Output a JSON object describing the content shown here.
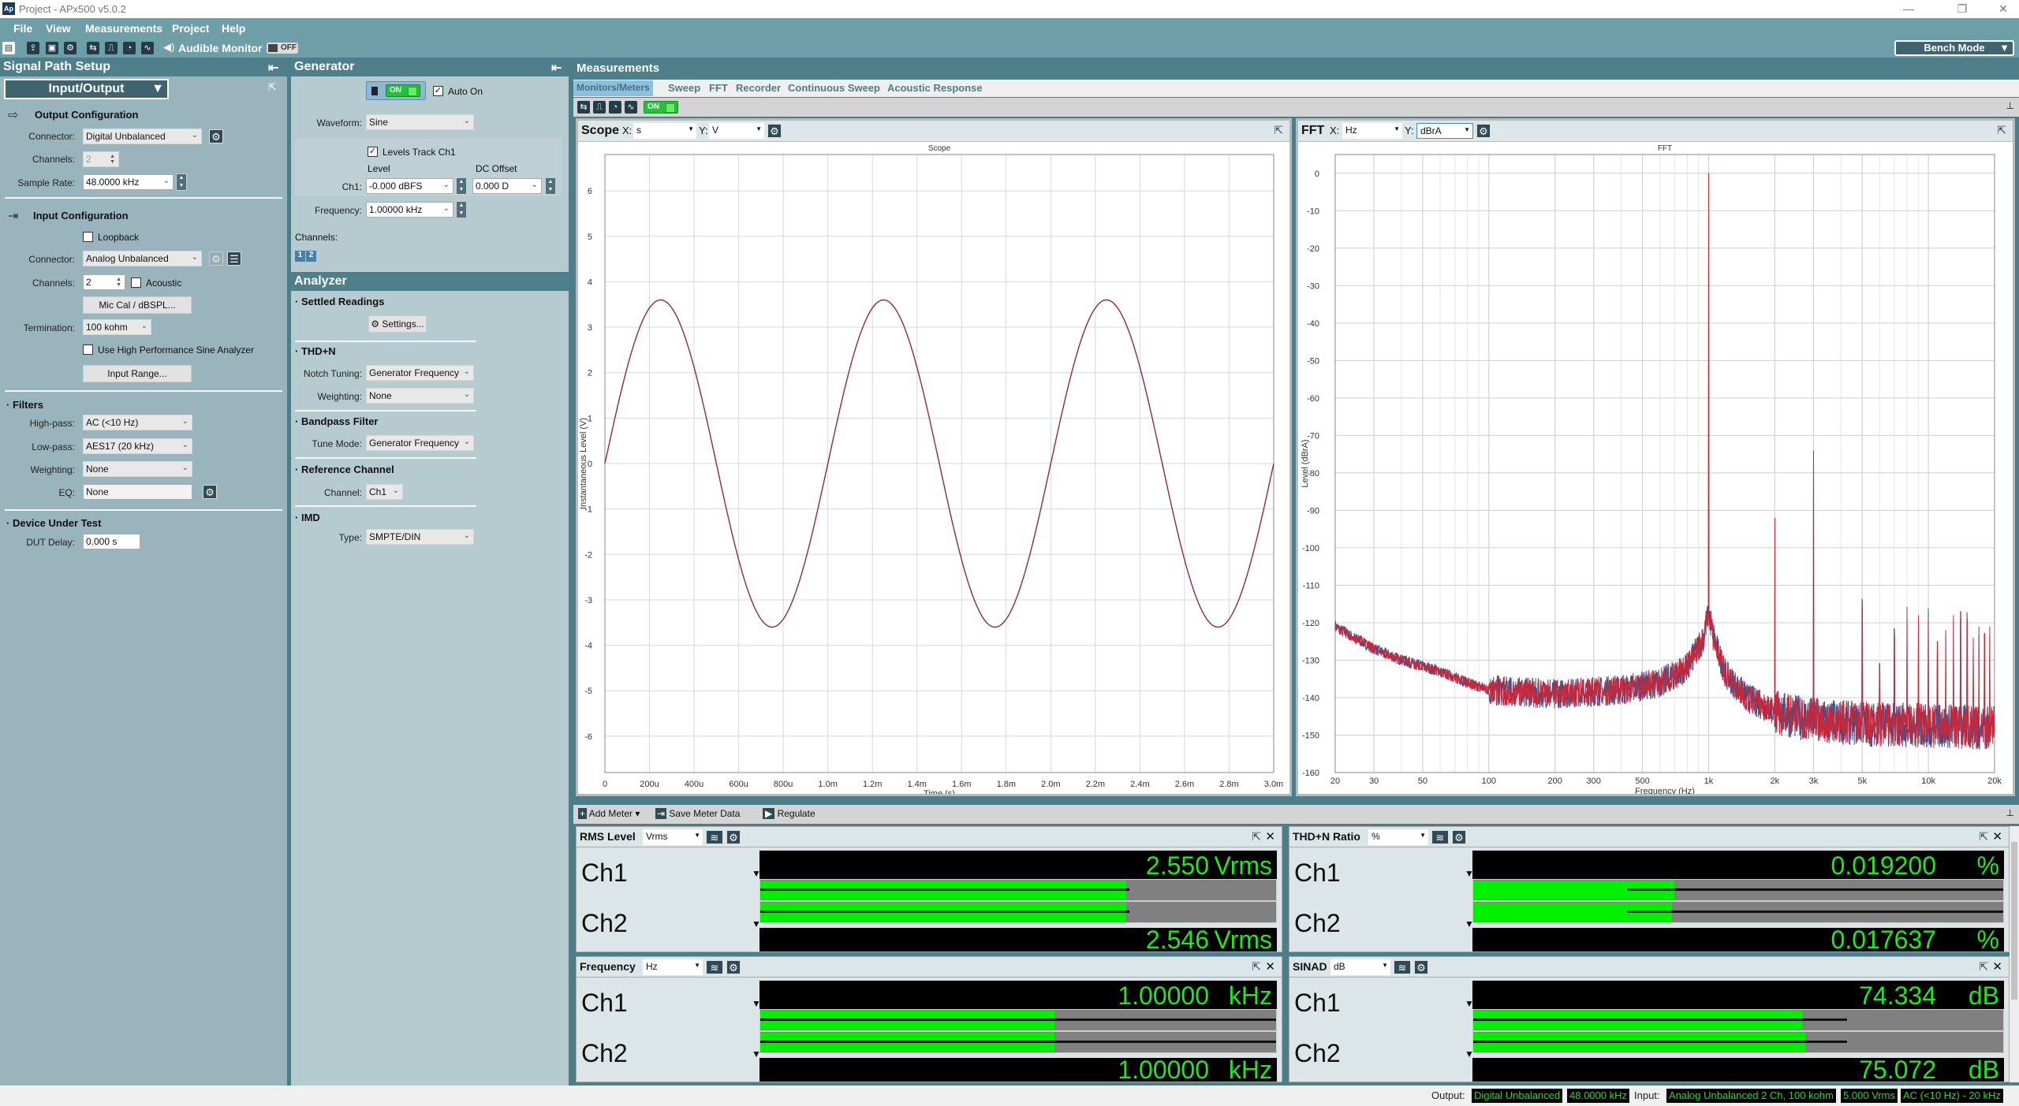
{
  "window": {
    "title": "Project - APx500 v5.0.2",
    "logo": "Ap",
    "minimize": "—",
    "restore": "❐",
    "close": "✕"
  },
  "menu": [
    "File",
    "View",
    "Measurements",
    "Project",
    "Help"
  ],
  "toolbar": {
    "audible_monitor_label": "Audible Monitor",
    "audible_monitor_state": "OFF",
    "icons": [
      "new-file-icon",
      "open-icon",
      "save-icon",
      "settings-icon",
      "routing-icon",
      "signal-icon",
      "clock-icon",
      "wave-add-icon",
      "speaker-icon"
    ],
    "mode": "Bench Mode"
  },
  "signal_path": {
    "title": "Signal Path Setup",
    "view": "Input/Output",
    "output": {
      "title": "Output Configuration",
      "connector_label": "Connector:",
      "connector": "Digital Unbalanced",
      "channels_label": "Channels:",
      "channels": "2",
      "sample_rate_label": "Sample Rate:",
      "sample_rate": "48.0000 kHz"
    },
    "input": {
      "title": "Input Configuration",
      "loopback": "Loopback",
      "loopback_checked": false,
      "connector_label": "Connector:",
      "connector": "Analog Unbalanced",
      "channels_label": "Channels:",
      "channels": "2",
      "acoustic": "Acoustic",
      "acoustic_checked": false,
      "mic_cal": "Mic Cal / dBSPL...",
      "termination_label": "Termination:",
      "termination": "100 kohm",
      "hp_sine": "Use High Performance Sine Analyzer",
      "hp_sine_checked": false,
      "input_range": "Input Range..."
    },
    "filters": {
      "title": "Filters",
      "highpass_label": "High-pass:",
      "highpass": "AC (<10 Hz)",
      "lowpass_label": "Low-pass:",
      "lowpass": "AES17 (20 kHz)",
      "weighting_label": "Weighting:",
      "weighting": "None",
      "eq_label": "EQ:",
      "eq": "None"
    },
    "dut": {
      "title": "Device Under Test",
      "delay_label": "DUT Delay:",
      "delay": "0.000 s"
    }
  },
  "generator": {
    "title": "Generator",
    "on_label": "ON",
    "auto_on": "Auto On",
    "auto_on_checked": true,
    "waveform_label": "Waveform:",
    "waveform": "Sine",
    "levels_track": "Levels Track Ch1",
    "levels_track_checked": true,
    "level_header": "Level",
    "dc_header": "DC Offset",
    "ch1_label": "Ch1:",
    "level": "-0.000 dBFS",
    "dc_offset": "0.000 D",
    "frequency_label": "Frequency:",
    "frequency": "1.00000 kHz",
    "channels_label": "Channels:",
    "channel_buttons": [
      "1",
      "2"
    ]
  },
  "analyzer": {
    "title": "Analyzer",
    "settled": "Settled Readings",
    "settings": "Settings...",
    "thdn": "THD+N",
    "notch_label": "Notch Tuning:",
    "notch": "Generator Frequency",
    "weighting_label": "Weighting:",
    "weighting": "None",
    "bandpass": "Bandpass Filter",
    "tune_label": "Tune Mode:",
    "tune": "Generator Frequency",
    "ref": "Reference Channel",
    "channel_label": "Channel:",
    "channel": "Ch1",
    "imd": "IMD",
    "type_label": "Type:",
    "type": "SMPTE/DIN"
  },
  "measurements": {
    "title": "Measurements",
    "tabs": [
      "Monitors/Meters",
      "Sweep",
      "FFT",
      "Recorder",
      "Continuous Sweep",
      "Acoustic Response"
    ],
    "active_tab": "Monitors/Meters",
    "on_label": "ON",
    "scope": {
      "name": "Scope",
      "x_label": "X:",
      "x_unit": "s",
      "y_label": "Y:",
      "y_unit": "V"
    },
    "fft": {
      "name": "FFT",
      "x_label": "X:",
      "x_unit": "Hz",
      "y_label": "Y:",
      "y_unit": "dBrA"
    },
    "meter_toolbar": {
      "add": "Add Meter",
      "save": "Save Meter Data",
      "regulate": "Regulate"
    },
    "meters": [
      {
        "name": "RMS Level",
        "unit_select": "Vrms",
        "channels": [
          {
            "ch": "Ch1",
            "value": "2.550",
            "unit": "Vrms",
            "fill": 0.71,
            "line": 0.715
          },
          {
            "ch": "Ch2",
            "value": "2.546",
            "unit": "Vrms",
            "fill": 0.71,
            "line": 0.715
          }
        ]
      },
      {
        "name": "THD+N Ratio",
        "unit_select": "%",
        "channels": [
          {
            "ch": "Ch1",
            "value": "0.019200",
            "unit": "%",
            "fill": 0.38,
            "line_from": 0.29
          },
          {
            "ch": "Ch2",
            "value": "0.017637",
            "unit": "%",
            "fill": 0.375,
            "line_from": 0.29
          }
        ]
      },
      {
        "name": "Frequency",
        "unit_select": "Hz",
        "channels": [
          {
            "ch": "Ch1",
            "value": "1.00000",
            "unit": "kHz",
            "fill": 0.57,
            "line": 1.0
          },
          {
            "ch": "Ch2",
            "value": "1.00000",
            "unit": "kHz",
            "fill": 0.57,
            "line": 1.0
          }
        ]
      },
      {
        "name": "SINAD",
        "unit_select": "dB",
        "channels": [
          {
            "ch": "Ch1",
            "value": "74.334",
            "unit": "dB",
            "fill": 0.62,
            "line": 0.705
          },
          {
            "ch": "Ch2",
            "value": "75.072",
            "unit": "dB",
            "fill": 0.626,
            "line": 0.705
          }
        ]
      }
    ]
  },
  "status": {
    "output_label": "Output:",
    "output": [
      "Digital Unbalanced",
      "48.0000 kHz"
    ],
    "input_label": "Input:",
    "input": [
      "Analog Unbalanced 2 Ch, 100 kohm",
      "5.000 Vrms",
      "AC (<10 Hz) - 20 kHz"
    ]
  },
  "colors": {
    "scope_trace": "#8b2c3c",
    "fft_ch1": "#3a4f8e",
    "fft_ch2": "#c4283c",
    "meter_text": "#22e622",
    "meter_fill": "#00f000"
  },
  "chart_data": [
    {
      "type": "line",
      "title": "Scope",
      "xlabel": "Time (s)",
      "ylabel": "Instantaneous Level (V)",
      "xlim": [
        0,
        0.003
      ],
      "ylim": [
        -6.8,
        6.8
      ],
      "grid": true,
      "xticks": [
        0,
        0.0002,
        0.0004,
        0.0006,
        0.0008,
        0.001,
        0.0012,
        0.0014,
        0.0016,
        0.0018,
        0.002,
        0.0022,
        0.0024,
        0.0026,
        0.0028,
        0.003
      ],
      "xtick_labels": [
        "0",
        "200u",
        "400u",
        "600u",
        "800u",
        "1.0m",
        "1.2m",
        "1.4m",
        "1.6m",
        "1.8m",
        "2.0m",
        "2.2m",
        "2.4m",
        "2.6m",
        "2.8m",
        "3.0m"
      ],
      "yticks": [
        6,
        5,
        4,
        3,
        2,
        1,
        0,
        -1,
        -2,
        -3,
        -4,
        -5,
        -6
      ],
      "series": [
        {
          "waveform": "sine",
          "amplitude_V": 3.6,
          "frequency_Hz": 1000,
          "phase_deg": 0
        }
      ]
    },
    {
      "type": "line",
      "title": "FFT",
      "xlabel": "Frequency (Hz)",
      "ylabel": "Level (dBrA)",
      "xscale": "log",
      "xlim": [
        20,
        20000
      ],
      "ylim": [
        -160,
        5
      ],
      "grid": true,
      "xticks": [
        20,
        30,
        50,
        100,
        200,
        300,
        500,
        1000,
        2000,
        3000,
        5000,
        10000,
        20000
      ],
      "xtick_labels": [
        "20",
        "30",
        "50",
        "100",
        "200",
        "300",
        "500",
        "1k",
        "2k",
        "3k",
        "5k",
        "10k",
        "20k"
      ],
      "yticks": [
        0,
        -10,
        -20,
        -30,
        -40,
        -50,
        -60,
        -70,
        -80,
        -90,
        -100,
        -110,
        -120,
        -130,
        -140,
        -150,
        -160
      ],
      "noise_floor": [
        [
          20,
          -121
        ],
        [
          30,
          -127
        ],
        [
          40,
          -130
        ],
        [
          60,
          -133
        ],
        [
          80,
          -136
        ],
        [
          100,
          -138
        ],
        [
          200,
          -139
        ],
        [
          400,
          -138
        ],
        [
          600,
          -136
        ],
        [
          800,
          -132
        ],
        [
          950,
          -124
        ],
        [
          1000,
          -117
        ],
        [
          1050,
          -124
        ],
        [
          1200,
          -134
        ],
        [
          1500,
          -140
        ],
        [
          2000,
          -144
        ],
        [
          3000,
          -146
        ],
        [
          5000,
          -147
        ],
        [
          20000,
          -148
        ]
      ],
      "peaks": [
        [
          1000,
          0
        ],
        [
          2000,
          -92
        ],
        [
          3000,
          -74
        ],
        [
          5000,
          -115
        ],
        [
          6000,
          -131
        ],
        [
          7000,
          -123
        ],
        [
          8000,
          -118
        ],
        [
          9000,
          -118
        ],
        [
          10000,
          -119
        ],
        [
          11000,
          -125
        ],
        [
          12000,
          -122
        ],
        [
          13000,
          -118
        ],
        [
          14000,
          -117
        ],
        [
          15000,
          -119
        ],
        [
          16000,
          -124
        ],
        [
          17000,
          -121
        ],
        [
          18000,
          -123
        ],
        [
          19000,
          -121
        ]
      ],
      "series": [
        {
          "channel": "Ch1",
          "color": "#3a4f8e"
        },
        {
          "channel": "Ch2",
          "color": "#c4283c"
        }
      ]
    }
  ]
}
